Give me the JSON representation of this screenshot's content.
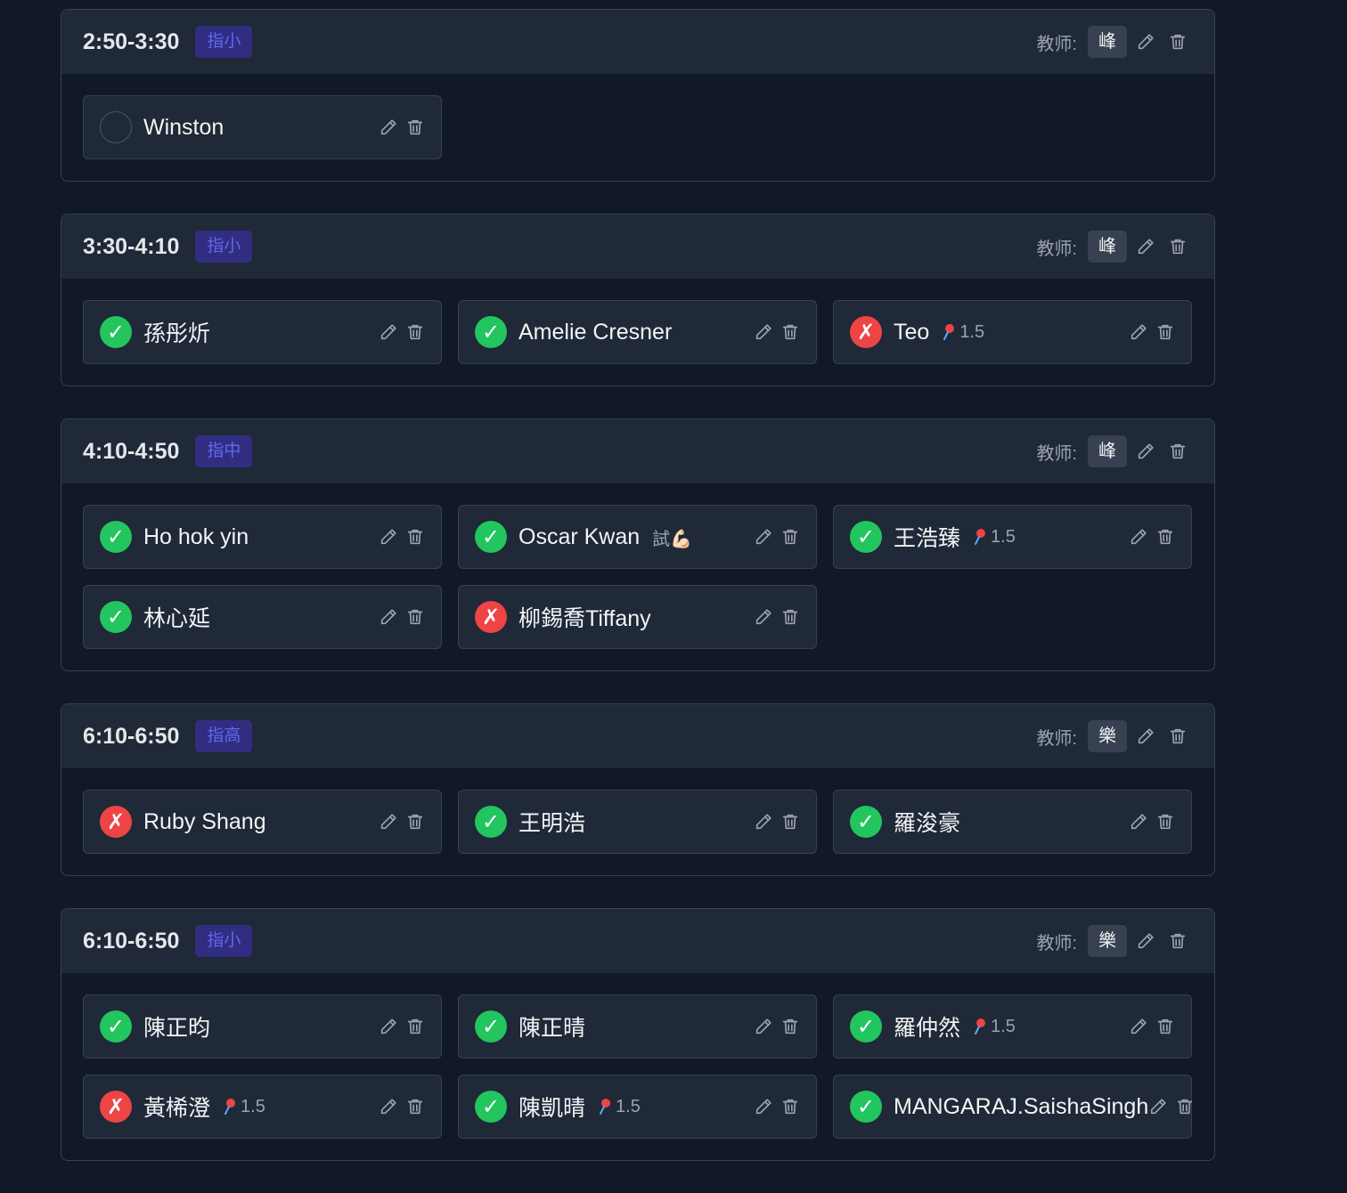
{
  "teacher_label": "教师:",
  "sessions": [
    {
      "time": "2:50-3:30",
      "level": "指小",
      "teacher": "峰",
      "students": [
        {
          "name": "Winston",
          "status": "unmarked",
          "tag": ""
        }
      ]
    },
    {
      "time": "3:30-4:10",
      "level": "指小",
      "teacher": "峰",
      "students": [
        {
          "name": "孫彤炘",
          "status": "present",
          "tag": ""
        },
        {
          "name": "Amelie Cresner",
          "status": "present",
          "tag": ""
        },
        {
          "name": "Teo",
          "status": "absent",
          "tag": "1.5",
          "tag_icon": "pushpin-icon"
        }
      ]
    },
    {
      "time": "4:10-4:50",
      "level": "指中",
      "teacher": "峰",
      "students": [
        {
          "name": "Ho hok yin",
          "status": "present",
          "tag": ""
        },
        {
          "name": "Oscar Kwan",
          "status": "present",
          "tag": "試💪🏻",
          "tag_icon": ""
        },
        {
          "name": "王浩臻",
          "status": "present",
          "tag": "1.5",
          "tag_icon": "pushpin-icon"
        },
        {
          "name": "林心延",
          "status": "present",
          "tag": ""
        },
        {
          "name": "柳錫喬Tiffany",
          "status": "absent",
          "tag": ""
        }
      ]
    },
    {
      "time": "6:10-6:50",
      "level": "指高",
      "teacher": "樂",
      "students": [
        {
          "name": "Ruby Shang",
          "status": "absent",
          "tag": ""
        },
        {
          "name": "王明浩",
          "status": "present",
          "tag": ""
        },
        {
          "name": "羅浚豪",
          "status": "present",
          "tag": ""
        }
      ]
    },
    {
      "time": "6:10-6:50",
      "level": "指小",
      "teacher": "樂",
      "students": [
        {
          "name": "陳正昀",
          "status": "present",
          "tag": ""
        },
        {
          "name": "陳正晴",
          "status": "present",
          "tag": ""
        },
        {
          "name": "羅仲然",
          "status": "present",
          "tag": "1.5",
          "tag_icon": "pushpin-icon"
        },
        {
          "name": "黃桸澄",
          "status": "absent",
          "tag": "1.5",
          "tag_icon": "pushpin-icon"
        },
        {
          "name": "陳凱晴",
          "status": "present",
          "tag": "1.5",
          "tag_icon": "pushpin-icon"
        },
        {
          "name": "MANGARAJ.SaishaSingh",
          "status": "present",
          "tag": ""
        }
      ]
    }
  ],
  "status_glyphs": {
    "present": "✓",
    "absent": "✗",
    "unmarked": ""
  },
  "colors": {
    "present": "#22c55e",
    "absent": "#ef4444",
    "level_bg": "#312e81",
    "level_text": "#6366f1"
  }
}
